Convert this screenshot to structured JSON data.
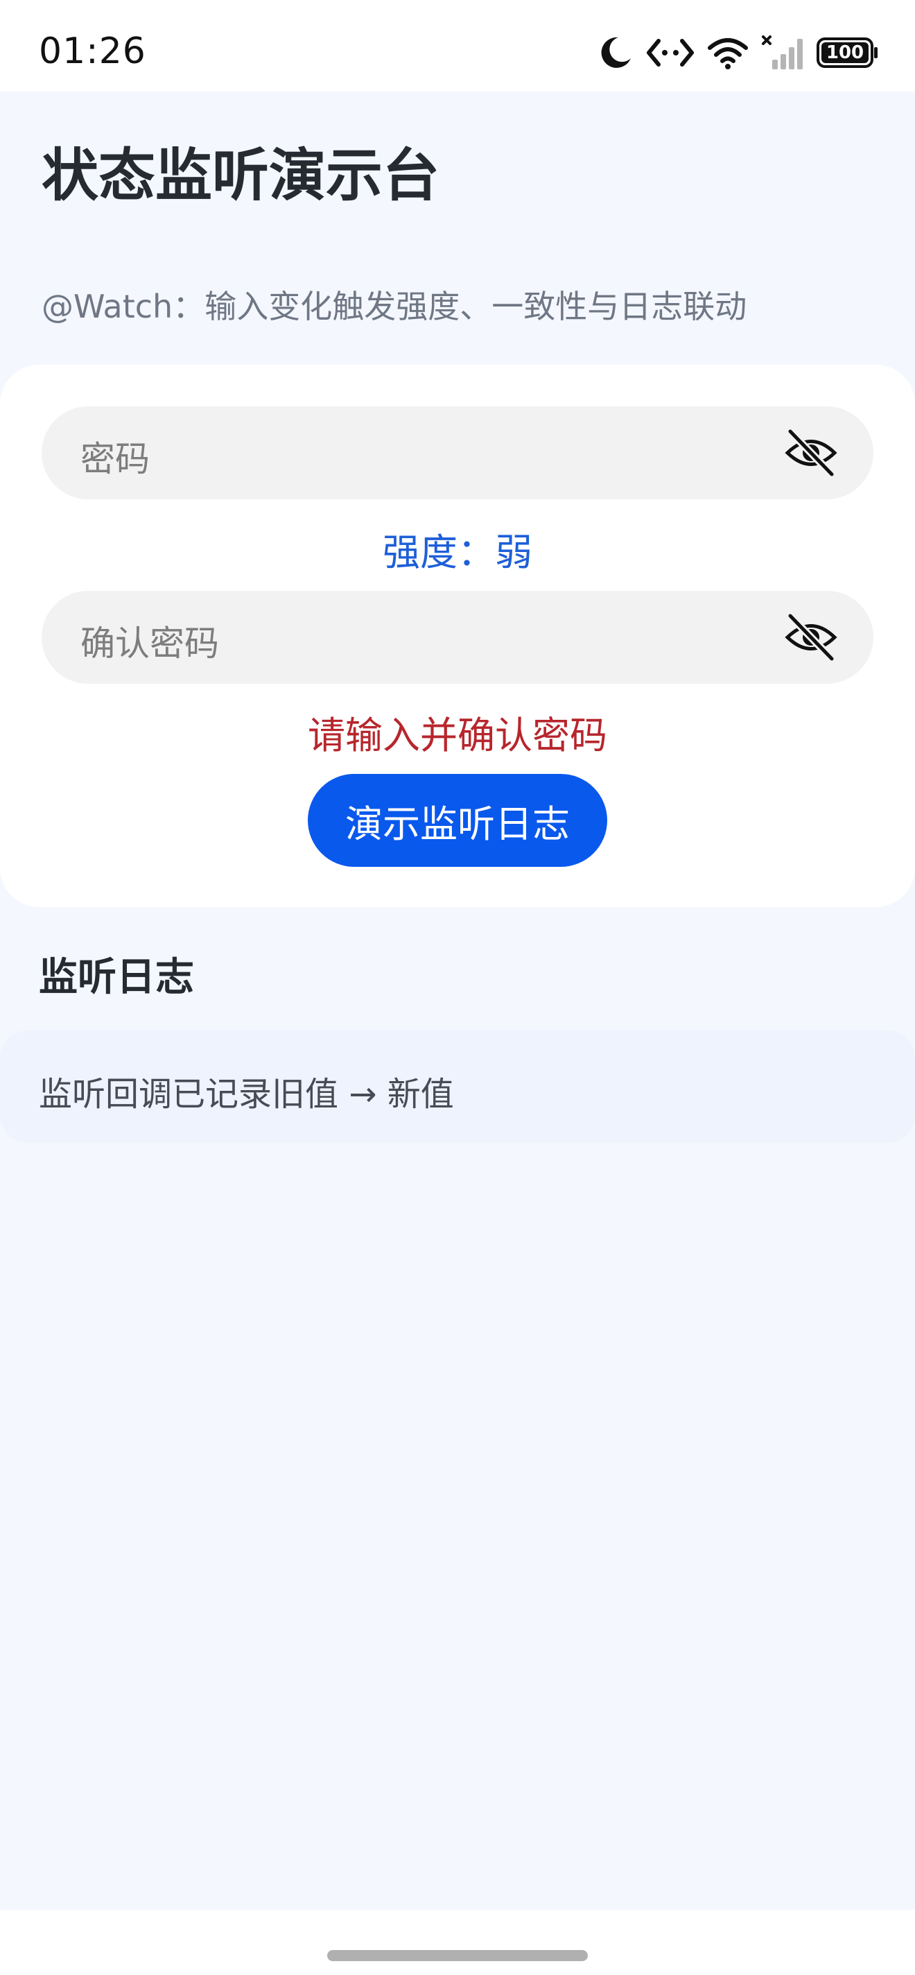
{
  "status_bar": {
    "time": "01:26",
    "battery": "100",
    "icons": [
      "moon-icon",
      "data-sync-icon",
      "wifi-icon",
      "cellular-signal-icon",
      "battery-icon"
    ]
  },
  "header": {
    "title": "状态监听演示台",
    "subtitle": "@Watch：输入变化触发强度、一致性与日志联动"
  },
  "form": {
    "password_placeholder": "密码",
    "confirm_placeholder": "确认密码",
    "strength_text": "强度：弱",
    "error_text": "请输入并确认密码",
    "button_label": "演示监听日志",
    "eye_icon": "eye-off-icon"
  },
  "log": {
    "title": "监听日志",
    "items": [
      "监听回调已记录旧值 → 新值"
    ]
  },
  "colors": {
    "background": "#f4f7fd",
    "card": "#ffffff",
    "accent": "#0a59ed",
    "strength": "#1e5fd8",
    "error": "#b7262c",
    "log_item_bg": "#eef3fd"
  }
}
